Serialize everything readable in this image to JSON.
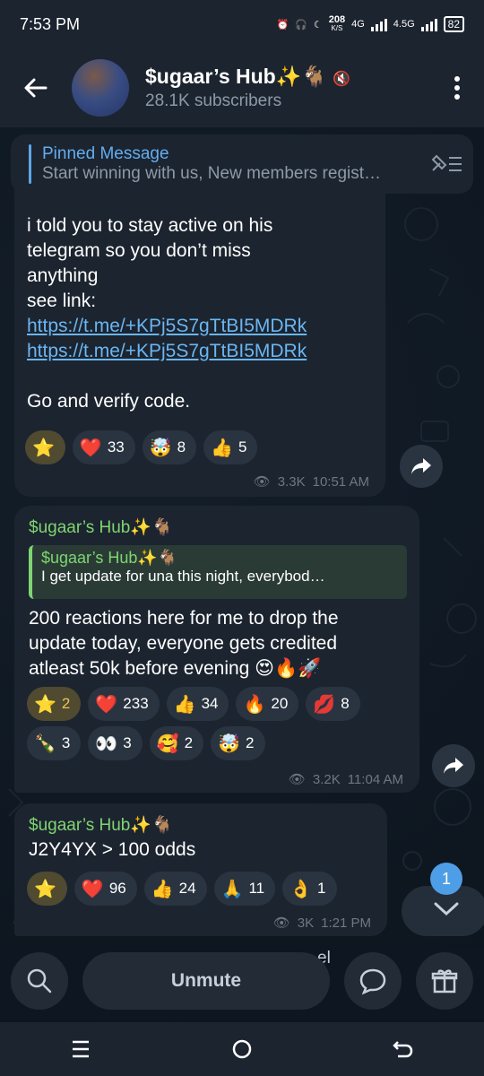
{
  "status": {
    "time": "7:53 PM",
    "net_speed": "208",
    "net_unit": "K/S",
    "net1": "4G",
    "net2": "4.5G",
    "battery": "82"
  },
  "header": {
    "channel_name": "$ugaar’s Hub✨🐐",
    "subscribers": "28.1K subscribers"
  },
  "pinned": {
    "title": "Pinned Message",
    "text": "Start winning with us, New members regist…"
  },
  "messages": [
    {
      "text_lines": [
        "i told you to stay active on his",
        "telegram so you don’t miss",
        "anything",
        "see link:"
      ],
      "links": [
        "https://t.me/+KPj5S7gTtBI5MDRk",
        "https://t.me/+KPj5S7gTtBI5MDRk"
      ],
      "closing": "Go and verify code.",
      "reactions": [
        {
          "emoji": "⭐",
          "count": ""
        },
        {
          "emoji": "❤️",
          "count": "33"
        },
        {
          "emoji": "🤯",
          "count": "8"
        },
        {
          "emoji": "👍",
          "count": "5"
        }
      ],
      "views": "3.3K",
      "time": "10:51 AM"
    },
    {
      "sender": "$ugaar’s Hub✨🐐",
      "quote_name": "$ugaar’s Hub✨🐐",
      "quote_text": "I get update for una this night, everybod…",
      "text_lines": [
        "200 reactions here for me to drop the",
        "update today, everyone gets credited",
        "atleast 50k before evening 😍🔥🚀"
      ],
      "reactions": [
        {
          "emoji": "⭐",
          "count": "2"
        },
        {
          "emoji": "❤️",
          "count": "233"
        },
        {
          "emoji": "👍",
          "count": "34"
        },
        {
          "emoji": "🔥",
          "count": "20"
        },
        {
          "emoji": "💋",
          "count": "8"
        },
        {
          "emoji": "🍾",
          "count": "3"
        },
        {
          "emoji": "👀",
          "count": "3"
        },
        {
          "emoji": "🥰",
          "count": "2"
        },
        {
          "emoji": "🤯",
          "count": "2"
        }
      ],
      "views": "3.2K",
      "time": "11:04 AM"
    },
    {
      "sender": "$ugaar’s Hub✨🐐",
      "text": "J2Y4YX  > 100 odds",
      "reactions": [
        {
          "emoji": "⭐",
          "count": ""
        },
        {
          "emoji": "❤️",
          "count": "96"
        },
        {
          "emoji": "👍",
          "count": "24"
        },
        {
          "emoji": "🙏",
          "count": "11"
        },
        {
          "emoji": "👌",
          "count": "1"
        }
      ],
      "views": "3K",
      "time": "1:21 PM"
    }
  ],
  "scroll_badge": "1",
  "bottom": {
    "unmute_label": "Unmute",
    "peek_text": "el"
  },
  "colors": {
    "background": "#0e1621",
    "bubble": "#1c242f",
    "accent": "#62aef0",
    "sender": "#7fd572"
  }
}
